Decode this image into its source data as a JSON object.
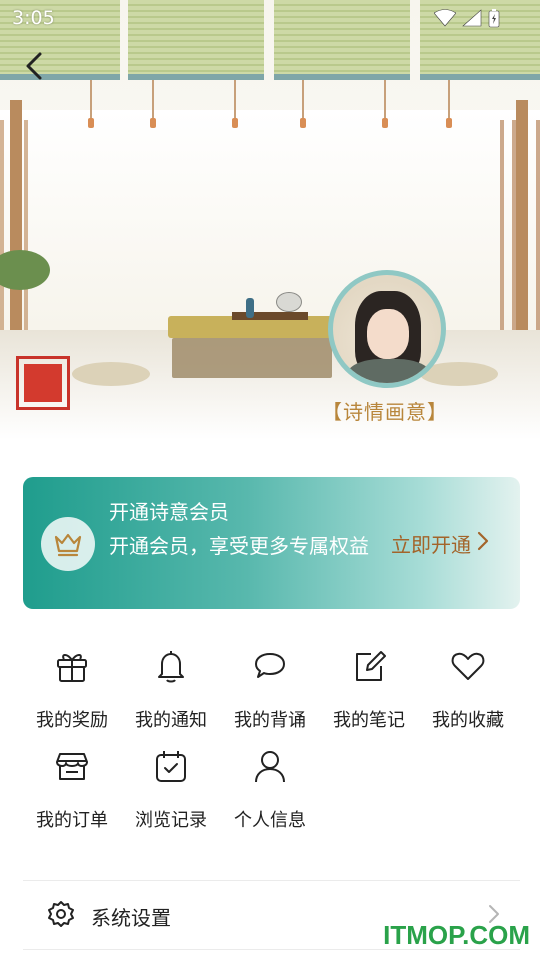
{
  "status_bar": {
    "time": "3:05"
  },
  "profile": {
    "title": "【诗情画意】"
  },
  "vip_card": {
    "title": "开通诗意会员",
    "description": "开通会员，享受更多专属权益",
    "action_label": "立即开通"
  },
  "shortcuts": [
    {
      "label": "我的奖励",
      "icon": "gift-icon"
    },
    {
      "label": "我的通知",
      "icon": "bell-icon"
    },
    {
      "label": "我的背诵",
      "icon": "chat-bubble-icon"
    },
    {
      "label": "我的笔记",
      "icon": "edit-note-icon"
    },
    {
      "label": "我的收藏",
      "icon": "heart-icon"
    },
    {
      "label": "我的订单",
      "icon": "store-icon"
    },
    {
      "label": "浏览记录",
      "icon": "calendar-check-icon"
    },
    {
      "label": "个人信息",
      "icon": "user-icon"
    }
  ],
  "settings": {
    "label": "系统设置",
    "icon": "gear-icon"
  },
  "watermark": "ITMOP.COM",
  "colors": {
    "accent": "#1f9d8d",
    "action": "#a3642a",
    "title_gold": "#b8863b",
    "seal_red": "#d33a2e"
  }
}
